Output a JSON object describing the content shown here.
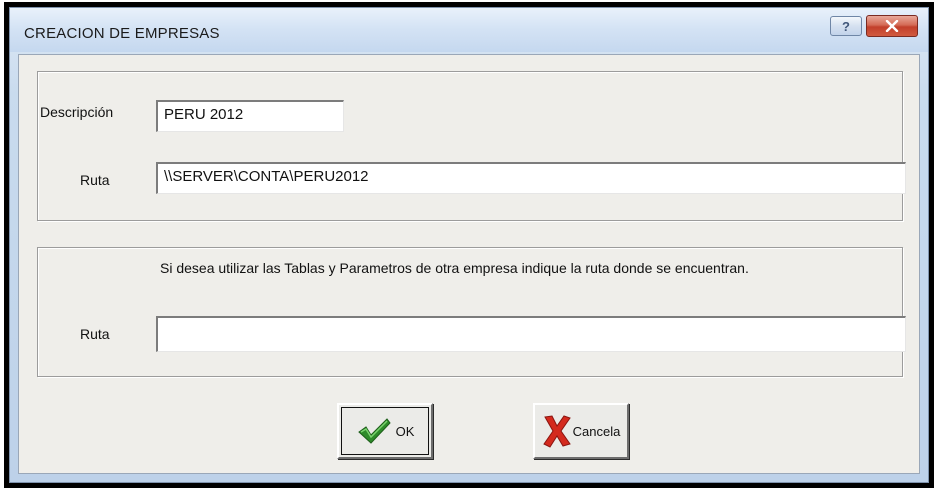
{
  "window": {
    "title": "CREACION DE EMPRESAS",
    "help_glyph": "?",
    "close_glyph": "✕"
  },
  "section1": {
    "descripcion_label": "Descripción",
    "descripcion_value": "PERU 2012",
    "ruta_label": "Ruta",
    "ruta_value": "\\\\SERVER\\CONTA\\PERU2012"
  },
  "section2": {
    "note": "Si desea utilizar las Tablas y Parametros de otra empresa indique la ruta donde se encuentran.",
    "ruta_label": "Ruta",
    "ruta_value": ""
  },
  "buttons": {
    "ok_label": "OK",
    "ok_icon": "checkmark-icon",
    "cancel_label": "Cancela",
    "cancel_icon": "x-icon"
  },
  "colors": {
    "ok_check": "#2e8b2a",
    "cancel_x": "#d42a1e"
  }
}
